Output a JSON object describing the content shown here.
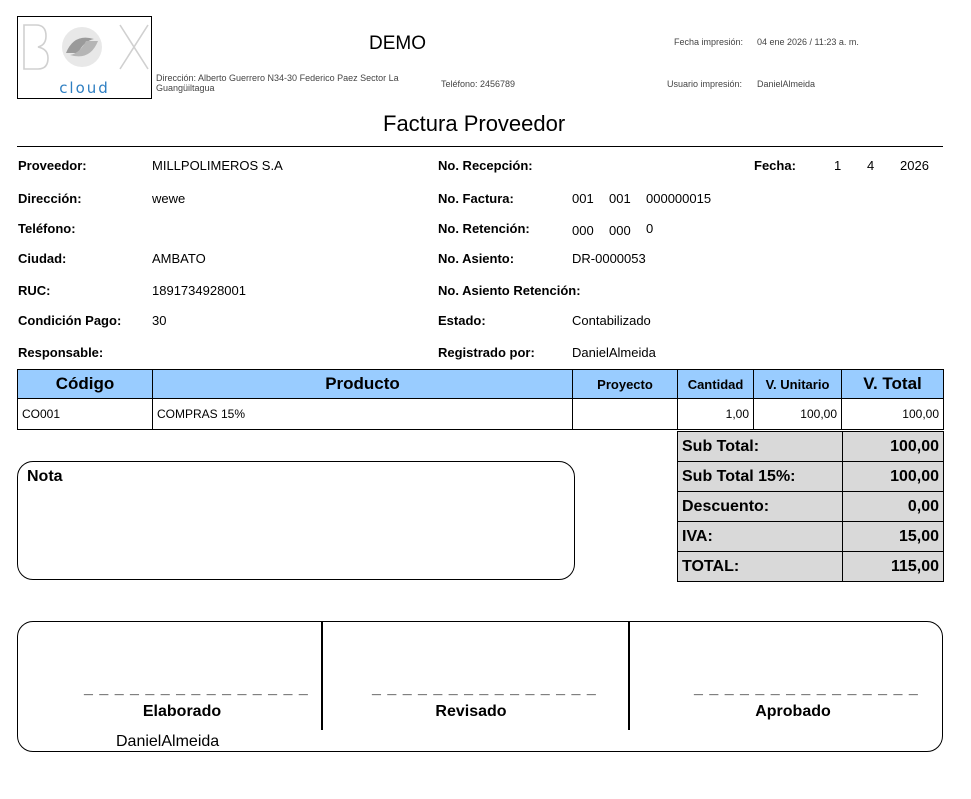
{
  "header": {
    "logo_text": "cloud",
    "company": "DEMO",
    "address": "Dirección: Alberto Guerrero N34-30 Federico Paez Sector La Guangüiltagua",
    "phone": "Teléfono: 2456789",
    "print_date_label": "Fecha impresión:",
    "print_date_value": "04 ene 2026 / 11:23 a. m.",
    "print_user_label": "Usuario impresión:",
    "print_user_value": "DanielAlmeida",
    "doc_title": "Factura Proveedor"
  },
  "info": {
    "proveedor_label": "Proveedor:",
    "proveedor": "MILLPOLIMEROS S.A",
    "direccion_label": "Dirección:",
    "direccion": "wewe",
    "telefono_label": "Teléfono:",
    "ciudad_label": "Ciudad:",
    "ciudad": "AMBATO",
    "ruc_label": "RUC:",
    "ruc": "1891734928001",
    "condicion_label": "Condición Pago:",
    "condicion": "30",
    "responsable_label": "Responsable:",
    "recepcion_label": "No. Recepción:",
    "factura_label": "No. Factura:",
    "factura_1": "001",
    "factura_2": "001",
    "factura_3": "000000015",
    "retencion_label": "No. Retención:",
    "retencion_1": "000",
    "retencion_2": "000",
    "retencion_3": "0",
    "asiento_label": "No. Asiento:",
    "asiento": "DR-0000053",
    "asiento_ret_label": "No. Asiento Retención:",
    "estado_label": "Estado:",
    "estado": "Contabilizado",
    "registrado_label": "Registrado por:",
    "registrado": "DanielAlmeida",
    "fecha_label": "Fecha:",
    "fecha_d": "1",
    "fecha_m": "4",
    "fecha_y": "2026"
  },
  "table": {
    "headers": [
      "Código",
      "Producto",
      "Proyecto",
      "Cantidad",
      "V. Unitario",
      "V. Total"
    ],
    "rows": [
      [
        "CO001",
        "COMPRAS 15%",
        "",
        "1,00",
        "100,00",
        "100,00"
      ]
    ]
  },
  "totals": [
    {
      "label": "Sub Total:",
      "value": "100,00"
    },
    {
      "label": "Sub Total 15%:",
      "value": "100,00"
    },
    {
      "label": "Descuento:",
      "value": "0,00"
    },
    {
      "label": "IVA:",
      "value": "15,00"
    },
    {
      "label": "TOTAL:",
      "value": "115,00"
    }
  ],
  "nota_label": "Nota",
  "signatures": {
    "dashes": "_ _ _ _ _ _ _ _ _ _ _ _ _ _ _",
    "elaborado": "Elaborado",
    "revisado": "Revisado",
    "aprobado": "Aprobado",
    "elaborado_name": "DanielAlmeida"
  }
}
